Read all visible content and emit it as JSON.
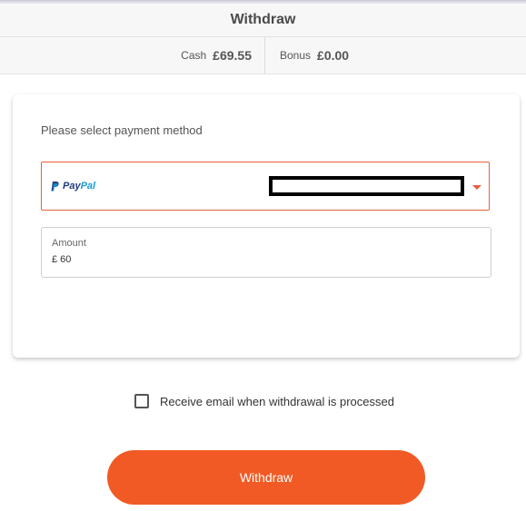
{
  "header": {
    "title": "Withdraw"
  },
  "balances": {
    "cash_label": "Cash",
    "cash_value": "£69.55",
    "bonus_label": "Bonus",
    "bonus_value": "£0.00"
  },
  "form": {
    "select_prompt": "Please select payment method",
    "payment_method": {
      "selected_pay": "Pay",
      "selected_pal": "Pal",
      "logo_icon": "paypal-icon",
      "account_redacted": true,
      "arrow_icon": "caret-down-icon"
    },
    "amount": {
      "label": "Amount",
      "value": "£ 60"
    },
    "email_checkbox": {
      "label": "Receive email when withdrawal is processed",
      "checked": false
    },
    "submit_label": "Withdraw"
  },
  "colors": {
    "accent": "#f15a24",
    "select_border": "#e8603c",
    "paypal_dark": "#253b80",
    "paypal_light": "#179bd7"
  }
}
